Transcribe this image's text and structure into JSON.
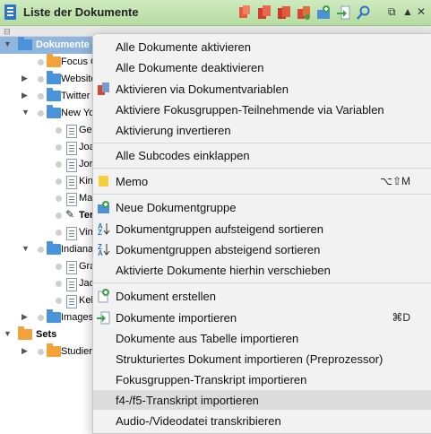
{
  "window": {
    "title": "Liste der Dokumente"
  },
  "tree": {
    "rows": [
      {
        "label": "Dokumente",
        "selected": true
      },
      {
        "label": "Focus G"
      },
      {
        "label": "Website"
      },
      {
        "label": "Twitter"
      },
      {
        "label": "New Yo"
      },
      {
        "label": "Ge"
      },
      {
        "label": "Joa"
      },
      {
        "label": "Jor"
      },
      {
        "label": "Kin"
      },
      {
        "label": "Ma"
      },
      {
        "label": "Ter"
      },
      {
        "label": "Vin"
      },
      {
        "label": "Indiana"
      },
      {
        "label": "Gra"
      },
      {
        "label": "Jac"
      },
      {
        "label": "Kel"
      },
      {
        "label": "Images"
      },
      {
        "label": "Sets"
      },
      {
        "label": "Studier"
      }
    ]
  },
  "menu": {
    "items": [
      {
        "label": "Alle Dokumente aktivieren"
      },
      {
        "label": "Alle Dokumente deaktivieren"
      },
      {
        "label": "Aktivieren via Dokumentvariablen"
      },
      {
        "label": "Aktiviere Fokusgruppen-Teilnehmende via Variablen"
      },
      {
        "label": "Aktivierung invertieren"
      },
      {
        "label": "Alle Subcodes einklappen"
      },
      {
        "label": "Memo",
        "shortcut": "⌥⇧M"
      },
      {
        "label": "Neue Dokumentgruppe"
      },
      {
        "label": "Dokumentgruppen aufsteigend sortieren"
      },
      {
        "label": "Dokumentgruppen absteigend sortieren"
      },
      {
        "label": "Aktivierte Dokumente hierhin verschieben"
      },
      {
        "label": "Dokument erstellen"
      },
      {
        "label": "Dokumente importieren",
        "shortcut": "⌘D"
      },
      {
        "label": "Dokumente aus Tabelle importieren"
      },
      {
        "label": "Strukturiertes Dokument importieren (Preprozessor)"
      },
      {
        "label": "Fokusgruppen-Transkript importieren"
      },
      {
        "label": "f4-/f5-Transkript importieren",
        "highlighted": true
      },
      {
        "label": "Audio-/Videodatei transkribieren"
      }
    ]
  },
  "colors": {
    "titlebar": "#b4dca0",
    "selection": "#8fb6de",
    "menu_bg": "#f2f2f2",
    "highlight": "#dcdcdc"
  }
}
